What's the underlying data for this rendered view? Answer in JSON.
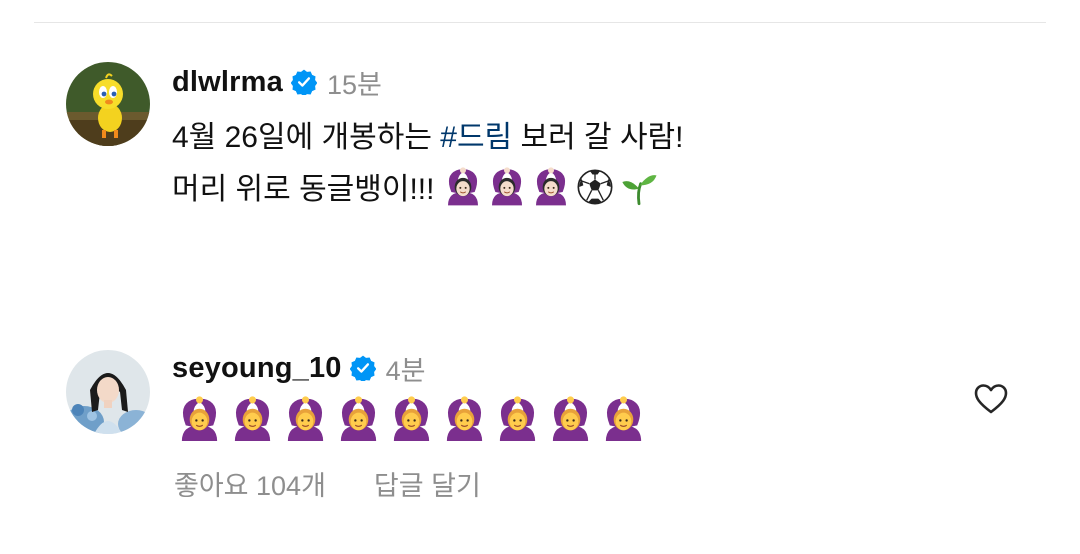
{
  "comments": [
    {
      "username": "dlwlrma",
      "verified": true,
      "time": "15분",
      "avatar_icon": "tweety-bird-avatar",
      "text_line1_pre": "4월 26일에 개봉하는 ",
      "text_line1_hashtag": "#드림",
      "text_line1_post": " 보러 갈 사람!",
      "text_line2": "머리 위로 동글뱅이!!! ",
      "emojis": [
        "person-gesturing-ok",
        "person-gesturing-ok",
        "person-gesturing-ok",
        "soccer-ball",
        "seedling"
      ]
    },
    {
      "username": "seyoung_10",
      "verified": true,
      "time": "4분",
      "avatar_icon": "profile-photo-avatar",
      "emojis": [
        "person-gesturing-ok",
        "person-gesturing-ok",
        "person-gesturing-ok",
        "person-gesturing-ok",
        "person-gesturing-ok",
        "person-gesturing-ok",
        "person-gesturing-ok",
        "person-gesturing-ok",
        "person-gesturing-ok"
      ],
      "likes": "좋아요 104개",
      "reply": "답글 달기",
      "like_icon": "heart-outline-icon"
    }
  ],
  "colors": {
    "hashtag": "#00376b",
    "verified": "#0095f6",
    "muted": "#8e8e8e"
  }
}
